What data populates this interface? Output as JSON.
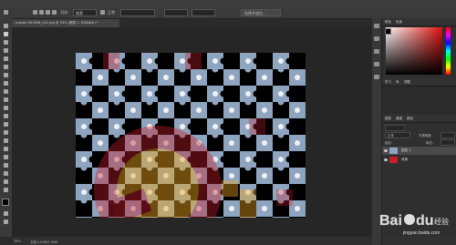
{
  "document_tab": "tuanjie-001896_001.jpg @ 33% (图层 1, RGB/8#) *",
  "options_bar": {
    "mode_value": "像素",
    "normal_label": "正常",
    "opacity_label": "不透明度:",
    "button_label": "选择并遮住..."
  },
  "status_bar": {
    "zoom": "33%",
    "info": "文档:1.03M/1.03M"
  },
  "panels": {
    "color_tabs": [
      "颜色",
      "色板"
    ],
    "properties_tabs": [
      "学习",
      "库",
      "调整"
    ],
    "layers_tabs": [
      "图层",
      "通道",
      "路径"
    ],
    "blend_mode": "正常",
    "opacity_label": "不透明度:",
    "lock_label": "锁定:",
    "fill_label": "填充:",
    "layers": [
      {
        "name": "图层 1",
        "selected": true
      },
      {
        "name": "背景",
        "selected": false
      }
    ]
  },
  "watermark": {
    "brand": "Bai",
    "paw": "du",
    "suffix": "经验",
    "url": "jingyan.baidu.com"
  },
  "colors": {
    "foreground": "#000000",
    "background": "#ffffff",
    "picker_hue": "#e01010",
    "artwork_blue": "#8ea4bf",
    "artwork_red": "#c81e2b",
    "artwork_yellow": "#f2a81d"
  }
}
